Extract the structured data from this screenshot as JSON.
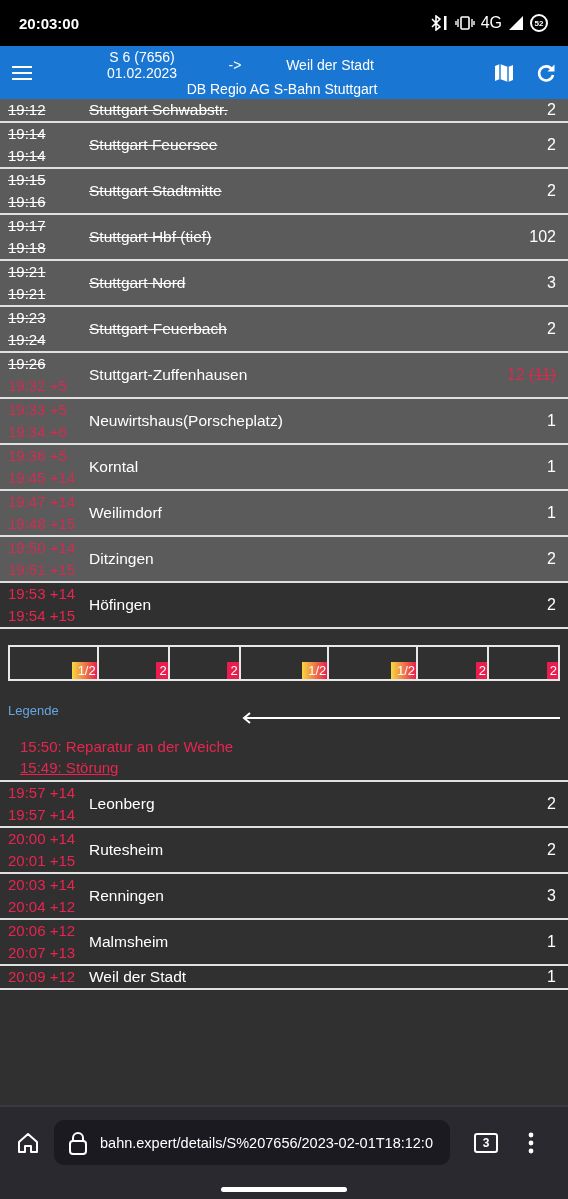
{
  "status_bar": {
    "time": "20:03:00",
    "network": "4G",
    "battery": "52"
  },
  "header": {
    "train": "S 6 (7656)",
    "date": "01.02.2023",
    "arrow": "->",
    "destination": "Weil der Stadt",
    "operator": "DB Regio AG S-Bahn Stuttgart"
  },
  "stops": [
    {
      "times": [
        {
          "text": "19:12",
          "delayed": false,
          "cancelled": true
        }
      ],
      "station": "Stuttgart Schwabstr.",
      "station_cancelled": true,
      "platform": "2",
      "platform_changed": false,
      "past": true
    },
    {
      "times": [
        {
          "text": "19:14",
          "delayed": false,
          "cancelled": true
        },
        {
          "text": "19:14",
          "delayed": false,
          "cancelled": true
        }
      ],
      "station": "Stuttgart Feuersee",
      "station_cancelled": true,
      "platform": "2",
      "platform_changed": false,
      "past": true
    },
    {
      "times": [
        {
          "text": "19:15",
          "delayed": false,
          "cancelled": true
        },
        {
          "text": "19:16",
          "delayed": false,
          "cancelled": true
        }
      ],
      "station": "Stuttgart Stadtmitte",
      "station_cancelled": true,
      "platform": "2",
      "platform_changed": false,
      "past": true
    },
    {
      "times": [
        {
          "text": "19:17",
          "delayed": false,
          "cancelled": true
        },
        {
          "text": "19:18",
          "delayed": false,
          "cancelled": true
        }
      ],
      "station": "Stuttgart Hbf (tief)",
      "station_cancelled": true,
      "platform": "102",
      "platform_changed": false,
      "past": true
    },
    {
      "times": [
        {
          "text": "19:21",
          "delayed": false,
          "cancelled": true
        },
        {
          "text": "19:21",
          "delayed": false,
          "cancelled": true
        }
      ],
      "station": "Stuttgart Nord",
      "station_cancelled": true,
      "platform": "3",
      "platform_changed": false,
      "past": true
    },
    {
      "times": [
        {
          "text": "19:23",
          "delayed": false,
          "cancelled": true
        },
        {
          "text": "19:24",
          "delayed": false,
          "cancelled": true
        }
      ],
      "station": "Stuttgart-Feuerbach",
      "station_cancelled": true,
      "platform": "2",
      "platform_changed": false,
      "past": true
    },
    {
      "times": [
        {
          "text": "19:26",
          "delayed": false,
          "cancelled": true
        },
        {
          "text": "19:32 +5",
          "delayed": true,
          "cancelled": false
        }
      ],
      "station": "Stuttgart-Zuffenhausen",
      "station_cancelled": false,
      "platform": "12",
      "platform_changed": true,
      "platform_planned": "(11)",
      "past": true
    },
    {
      "times": [
        {
          "text": "19:33 +5",
          "delayed": true,
          "cancelled": false
        },
        {
          "text": "19:34 +6",
          "delayed": true,
          "cancelled": false
        }
      ],
      "station": "Neuwirtshaus(Porscheplatz)",
      "station_cancelled": false,
      "platform": "1",
      "platform_changed": false,
      "past": true
    },
    {
      "times": [
        {
          "text": "19:36 +5",
          "delayed": true,
          "cancelled": false
        },
        {
          "text": "19:45 +14",
          "delayed": true,
          "cancelled": false
        }
      ],
      "station": "Korntal",
      "station_cancelled": false,
      "platform": "1",
      "platform_changed": false,
      "past": true
    },
    {
      "times": [
        {
          "text": "19:47 +14",
          "delayed": true,
          "cancelled": false
        },
        {
          "text": "19:48 +15",
          "delayed": true,
          "cancelled": false
        }
      ],
      "station": "Weilimdorf",
      "station_cancelled": false,
      "platform": "1",
      "platform_changed": false,
      "past": true
    },
    {
      "times": [
        {
          "text": "19:50 +14",
          "delayed": true,
          "cancelled": false
        },
        {
          "text": "19:51 +15",
          "delayed": true,
          "cancelled": false
        }
      ],
      "station": "Ditzingen",
      "station_cancelled": false,
      "platform": "2",
      "platform_changed": false,
      "past": true
    },
    {
      "times": [
        {
          "text": "19:53 +14",
          "delayed": true,
          "cancelled": false
        },
        {
          "text": "19:54 +15",
          "delayed": true,
          "cancelled": false
        }
      ],
      "station": "Höfingen",
      "station_cancelled": false,
      "platform": "2",
      "platform_changed": false,
      "past": false,
      "wagons": [
        {
          "class": "1/2",
          "kind": "first"
        },
        {
          "class": "2",
          "kind": "second"
        },
        {
          "class": "2",
          "kind": "second"
        },
        {
          "class": "1/2",
          "kind": "first"
        },
        {
          "class": "1/2",
          "kind": "first"
        },
        {
          "class": "2",
          "kind": "second"
        },
        {
          "class": "2",
          "kind": "second"
        }
      ],
      "legend": "Legende",
      "messages": [
        {
          "text": "15:50: Reparatur an der Weiche",
          "underlined": false
        },
        {
          "text": "15:49: Störung",
          "underlined": true
        }
      ]
    },
    {
      "times": [
        {
          "text": "19:57 +14",
          "delayed": true,
          "cancelled": false
        },
        {
          "text": "19:57 +14",
          "delayed": true,
          "cancelled": false
        }
      ],
      "station": "Leonberg",
      "station_cancelled": false,
      "platform": "2",
      "platform_changed": false,
      "past": false
    },
    {
      "times": [
        {
          "text": "20:00 +14",
          "delayed": true,
          "cancelled": false
        },
        {
          "text": "20:01 +15",
          "delayed": true,
          "cancelled": false
        }
      ],
      "station": "Rutesheim",
      "station_cancelled": false,
      "platform": "2",
      "platform_changed": false,
      "past": false
    },
    {
      "times": [
        {
          "text": "20:03 +14",
          "delayed": true,
          "cancelled": false
        },
        {
          "text": "20:04 +12",
          "delayed": true,
          "cancelled": false
        }
      ],
      "station": "Renningen",
      "station_cancelled": false,
      "platform": "3",
      "platform_changed": false,
      "past": false
    },
    {
      "times": [
        {
          "text": "20:06 +12",
          "delayed": true,
          "cancelled": false
        },
        {
          "text": "20:07 +13",
          "delayed": true,
          "cancelled": false
        }
      ],
      "station": "Malmsheim",
      "station_cancelled": false,
      "platform": "1",
      "platform_changed": false,
      "past": false
    },
    {
      "times": [
        {
          "text": "20:09 +12",
          "delayed": true,
          "cancelled": false
        }
      ],
      "station": "Weil der Stadt",
      "station_cancelled": false,
      "platform": "1",
      "platform_changed": false,
      "past": false
    }
  ],
  "browser": {
    "url": "bahn.expert/details/S%207656/2023-02-01T18:12:0",
    "tab_count": "3"
  }
}
